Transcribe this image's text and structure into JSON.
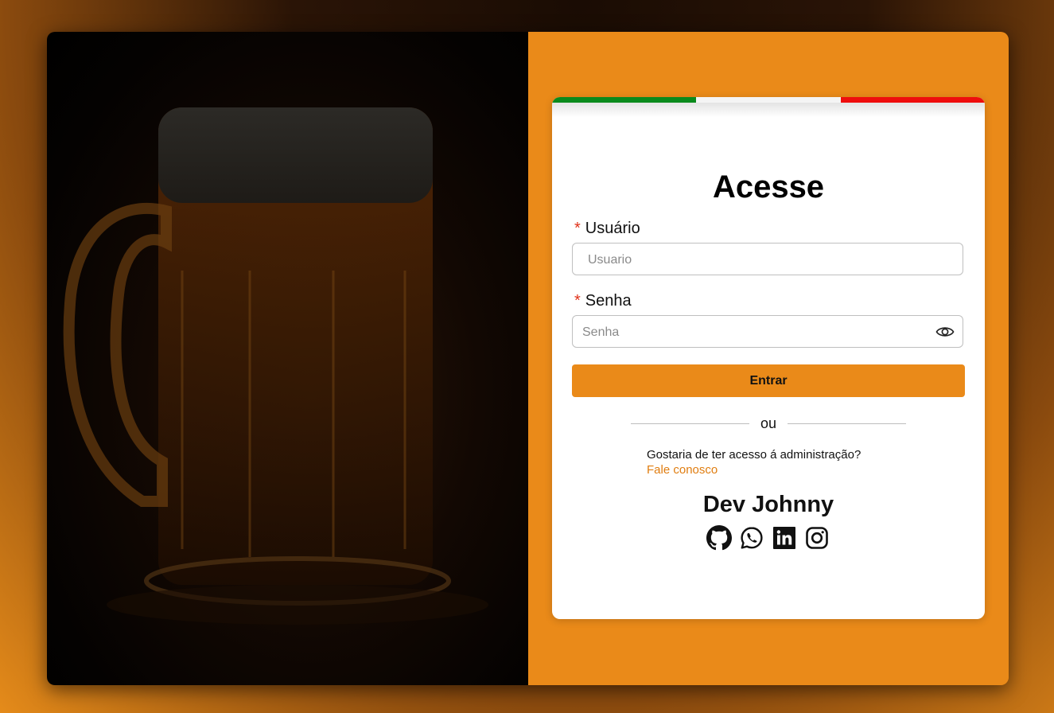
{
  "login": {
    "title": "Acesse",
    "required_mark": "*",
    "username_label": "Usuário",
    "username_placeholder": "Usuario",
    "password_label": "Senha",
    "password_placeholder": "Senha",
    "submit_label": "Entrar",
    "divider_text": "ou",
    "admin_question": "Gostaria de ter acesso á administração?",
    "contact_link": "Fale conosco",
    "developer_name": "Dev Johnny"
  },
  "icons": {
    "password_toggle": "eye-icon",
    "socials": [
      "github-icon",
      "whatsapp-icon",
      "linkedin-icon",
      "instagram-icon"
    ]
  },
  "colors": {
    "accent": "#ea8a19",
    "link": "#e07d10",
    "flag_green": "#0a8a1c",
    "flag_white": "#f4f4f4",
    "flag_red": "#ef0d0d"
  }
}
